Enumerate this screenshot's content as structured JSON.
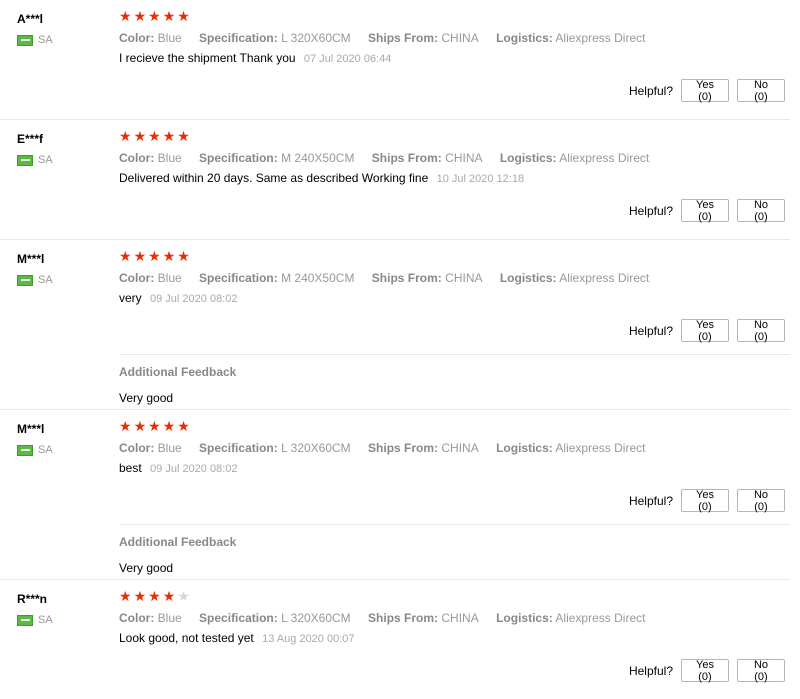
{
  "helpful_label": "Helpful?",
  "colors": {
    "star": "#e62e04",
    "star_empty": "#d6d6d6",
    "flag": "#5fb845"
  },
  "reviews": [
    {
      "name": "A***l",
      "country": "SA",
      "rating": 5,
      "specs": [
        {
          "key": "Color:",
          "value": "Blue"
        },
        {
          "key": "Specification:",
          "value": "L 320X60CM"
        },
        {
          "key": "Ships From:",
          "value": "CHINA"
        },
        {
          "key": "Logistics:",
          "value": "Aliexpress Direct"
        }
      ],
      "text": "I recieve the shipment Thank you",
      "date": "07 Jul 2020 06:44",
      "yes_label": "Yes (0)",
      "no_label": "No (0)"
    },
    {
      "name": "E***f",
      "country": "SA",
      "rating": 5,
      "specs": [
        {
          "key": "Color:",
          "value": "Blue"
        },
        {
          "key": "Specification:",
          "value": "M 240X50CM"
        },
        {
          "key": "Ships From:",
          "value": "CHINA"
        },
        {
          "key": "Logistics:",
          "value": "Aliexpress Direct"
        }
      ],
      "text": "Delivered within 20 days. Same as described Working fine",
      "date": "10 Jul 2020 12:18",
      "yes_label": "Yes (0)",
      "no_label": "No (0)"
    },
    {
      "name": "M***l",
      "country": "SA",
      "rating": 5,
      "specs": [
        {
          "key": "Color:",
          "value": "Blue"
        },
        {
          "key": "Specification:",
          "value": "M 240X50CM"
        },
        {
          "key": "Ships From:",
          "value": "CHINA"
        },
        {
          "key": "Logistics:",
          "value": "Aliexpress Direct"
        }
      ],
      "text": "very",
      "date": "09 Jul 2020 08:02",
      "yes_label": "Yes (0)",
      "no_label": "No (0)",
      "additional_title": "Additional Feedback",
      "additional_text": "Very good"
    },
    {
      "name": "M***l",
      "country": "SA",
      "rating": 5,
      "specs": [
        {
          "key": "Color:",
          "value": "Blue"
        },
        {
          "key": "Specification:",
          "value": "L 320X60CM"
        },
        {
          "key": "Ships From:",
          "value": "CHINA"
        },
        {
          "key": "Logistics:",
          "value": "Aliexpress Direct"
        }
      ],
      "text": "best",
      "date": "09 Jul 2020 08:02",
      "yes_label": "Yes (0)",
      "no_label": "No (0)",
      "additional_title": "Additional Feedback",
      "additional_text": "Very good"
    },
    {
      "name": "R***n",
      "country": "SA",
      "rating": 4,
      "specs": [
        {
          "key": "Color:",
          "value": "Blue"
        },
        {
          "key": "Specification:",
          "value": "L 320X60CM"
        },
        {
          "key": "Ships From:",
          "value": "CHINA"
        },
        {
          "key": "Logistics:",
          "value": "Aliexpress Direct"
        }
      ],
      "text": "Look good, not tested yet",
      "date": "13 Aug 2020 00:07",
      "yes_label": "Yes (0)",
      "no_label": "No (0)"
    }
  ]
}
